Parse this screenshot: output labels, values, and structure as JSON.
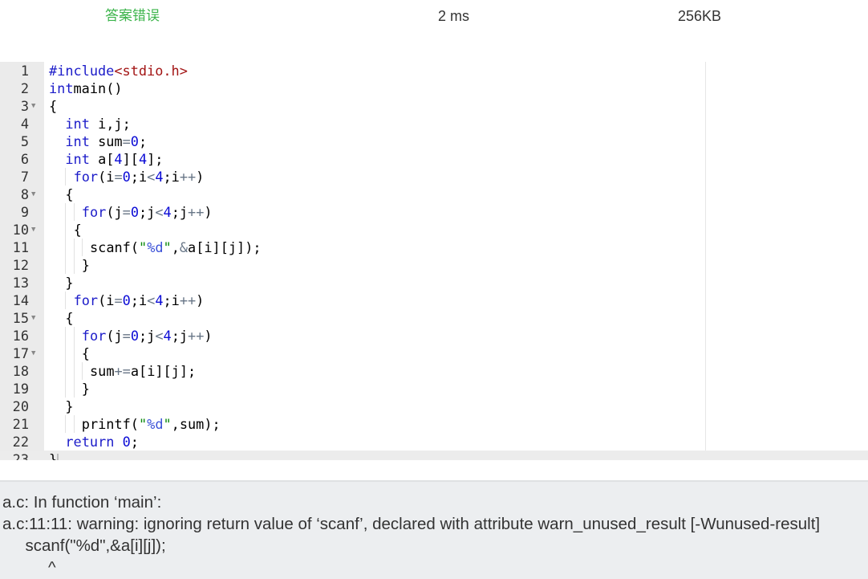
{
  "status": {
    "result": "答案错误",
    "time": "2 ms",
    "memory": "256KB",
    "result_color": "#3cb44b"
  },
  "editor": {
    "active_line": 23,
    "fold_lines": [
      3,
      8,
      10,
      15,
      17
    ],
    "lines": [
      {
        "indent": 0,
        "tokens": [
          [
            "pp",
            "#include"
          ],
          [
            "inc",
            "<stdio.h>"
          ]
        ]
      },
      {
        "indent": 0,
        "tokens": [
          [
            "kw",
            "int"
          ],
          [
            "",
            "main()"
          ]
        ]
      },
      {
        "indent": 0,
        "tokens": [
          [
            "",
            "{"
          ]
        ]
      },
      {
        "indent": 2,
        "tokens": [
          [
            "kw",
            "int"
          ],
          [
            "",
            " i,j;"
          ]
        ]
      },
      {
        "indent": 2,
        "tokens": [
          [
            "kw",
            "int"
          ],
          [
            "",
            " sum"
          ],
          [
            "op",
            "="
          ],
          [
            "num",
            "0"
          ],
          [
            "",
            ";"
          ]
        ]
      },
      {
        "indent": 2,
        "tokens": [
          [
            "kw",
            "int"
          ],
          [
            "",
            " a["
          ],
          [
            "num",
            "4"
          ],
          [
            "",
            "]["
          ],
          [
            "num",
            "4"
          ],
          [
            "",
            "];"
          ]
        ]
      },
      {
        "indent": 3,
        "tokens": [
          [
            "kw",
            "for"
          ],
          [
            "",
            "(i"
          ],
          [
            "op",
            "="
          ],
          [
            "num",
            "0"
          ],
          [
            "",
            ";i"
          ],
          [
            "op",
            "<"
          ],
          [
            "num",
            "4"
          ],
          [
            "",
            ";i"
          ],
          [
            "op",
            "++"
          ],
          [
            "",
            ")"
          ]
        ]
      },
      {
        "indent": 2,
        "tokens": [
          [
            "",
            "{"
          ]
        ]
      },
      {
        "indent": 4,
        "tokens": [
          [
            "kw",
            "for"
          ],
          [
            "",
            "(j"
          ],
          [
            "op",
            "="
          ],
          [
            "num",
            "0"
          ],
          [
            "",
            ";j"
          ],
          [
            "op",
            "<"
          ],
          [
            "num",
            "4"
          ],
          [
            "",
            ";j"
          ],
          [
            "op",
            "++"
          ],
          [
            "",
            ")"
          ]
        ]
      },
      {
        "indent": 3,
        "tokens": [
          [
            "",
            "{"
          ]
        ]
      },
      {
        "indent": 5,
        "tokens": [
          [
            "",
            "scanf("
          ],
          [
            "str",
            "\""
          ],
          [
            "fmt",
            "%d"
          ],
          [
            "str",
            "\""
          ],
          [
            "",
            ","
          ],
          [
            "op",
            "&"
          ],
          [
            "",
            "a[i][j]);"
          ]
        ]
      },
      {
        "indent": 4,
        "tokens": [
          [
            "",
            "}"
          ]
        ]
      },
      {
        "indent": 2,
        "tokens": [
          [
            "",
            "}"
          ]
        ]
      },
      {
        "indent": 3,
        "tokens": [
          [
            "kw",
            "for"
          ],
          [
            "",
            "(i"
          ],
          [
            "op",
            "="
          ],
          [
            "num",
            "0"
          ],
          [
            "",
            ";i"
          ],
          [
            "op",
            "<"
          ],
          [
            "num",
            "4"
          ],
          [
            "",
            ";i"
          ],
          [
            "op",
            "++"
          ],
          [
            "",
            ")"
          ]
        ]
      },
      {
        "indent": 2,
        "tokens": [
          [
            "",
            "{"
          ]
        ]
      },
      {
        "indent": 4,
        "tokens": [
          [
            "kw",
            "for"
          ],
          [
            "",
            "(j"
          ],
          [
            "op",
            "="
          ],
          [
            "num",
            "0"
          ],
          [
            "",
            ";j"
          ],
          [
            "op",
            "<"
          ],
          [
            "num",
            "4"
          ],
          [
            "",
            ";j"
          ],
          [
            "op",
            "++"
          ],
          [
            "",
            ")"
          ]
        ]
      },
      {
        "indent": 4,
        "tokens": [
          [
            "",
            "{"
          ]
        ]
      },
      {
        "indent": 5,
        "tokens": [
          [
            "",
            "sum"
          ],
          [
            "op",
            "+="
          ],
          [
            "",
            "a[i][j];"
          ]
        ]
      },
      {
        "indent": 4,
        "tokens": [
          [
            "",
            "}"
          ]
        ]
      },
      {
        "indent": 2,
        "tokens": [
          [
            "",
            "}"
          ]
        ]
      },
      {
        "indent": 4,
        "tokens": [
          [
            "",
            "printf("
          ],
          [
            "str",
            "\""
          ],
          [
            "fmt",
            "%d"
          ],
          [
            "str",
            "\""
          ],
          [
            "",
            ",sum);"
          ]
        ]
      },
      {
        "indent": 2,
        "tokens": [
          [
            "kw",
            "return"
          ],
          [
            "",
            " "
          ],
          [
            "num",
            "0"
          ],
          [
            "",
            ";"
          ]
        ]
      },
      {
        "indent": 0,
        "tokens": [
          [
            "",
            "}"
          ]
        ]
      }
    ]
  },
  "output": {
    "line1": "a.c: In function ‘main’:",
    "line2": "a.c:11:11: warning: ignoring return value of ‘scanf’, declared with attribute warn_unused_result [-Wunused-result]",
    "line3": "     scanf(\"%d\",&a[i][j]);",
    "line4": "          ^"
  }
}
